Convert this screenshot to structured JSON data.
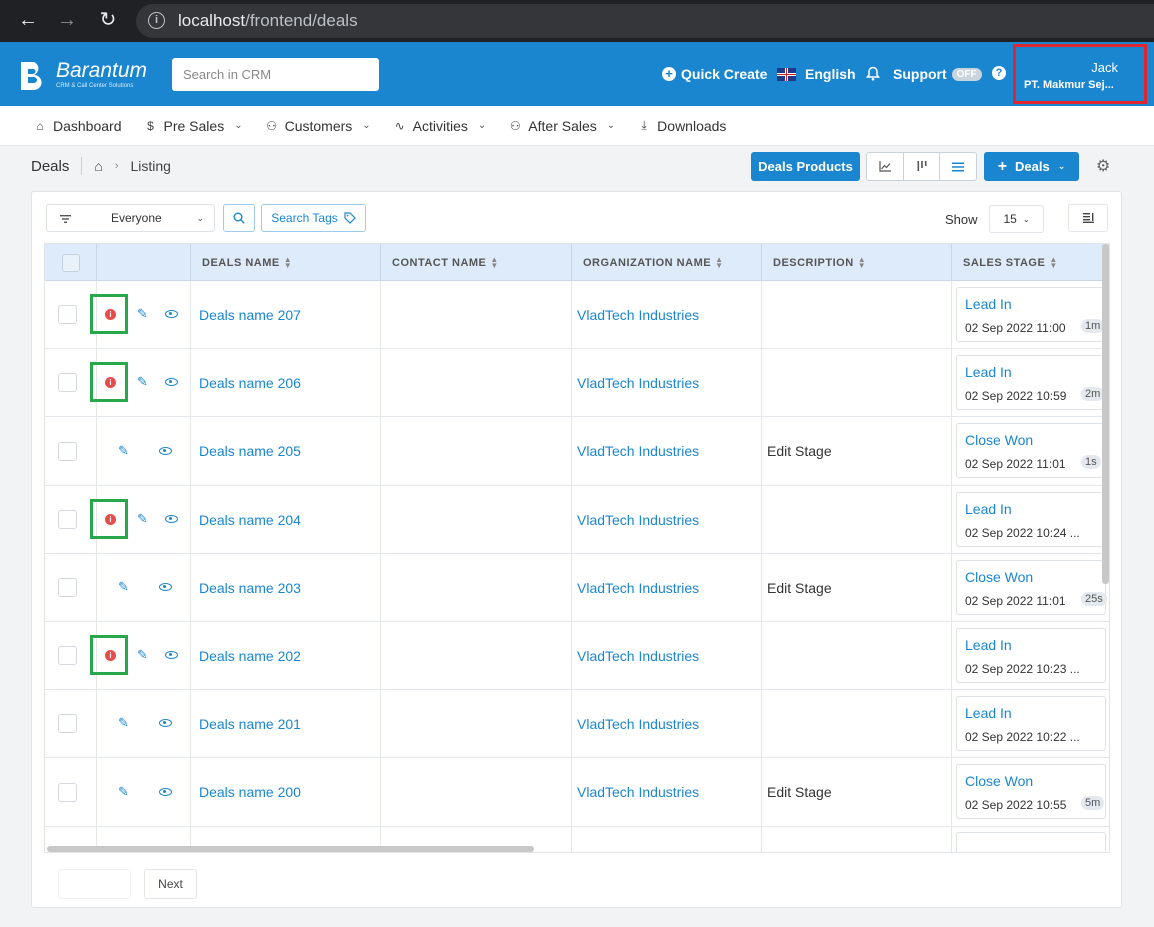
{
  "browser": {
    "url_host": "localhost",
    "url_path": "/frontend/deals"
  },
  "header": {
    "brand": "Barantum",
    "tagline": "CRM & Call Center Solutions",
    "search_placeholder": "Search in CRM",
    "quick_create": "Quick Create",
    "language": "English",
    "support": "Support",
    "support_status": "OFF",
    "user_name": "Jack",
    "user_org": "PT. Makmur Sej..."
  },
  "nav": {
    "items": [
      {
        "label": "Dashboard"
      },
      {
        "label": "Pre Sales"
      },
      {
        "label": "Customers"
      },
      {
        "label": "Activities"
      },
      {
        "label": "After Sales"
      },
      {
        "label": "Downloads"
      }
    ]
  },
  "page": {
    "title": "Deals",
    "crumb": "Listing",
    "deals_products_label": "Deals Products",
    "deals_button_label": "Deals"
  },
  "toolbar": {
    "filter_value": "Everyone",
    "search_tags_label": "Search Tags",
    "show_label": "Show",
    "show_value": "15"
  },
  "table": {
    "columns": [
      "DEALS NAME",
      "CONTACT NAME",
      "ORGANIZATION NAME",
      "DESCRIPTION",
      "SALES STAGE"
    ],
    "rows": [
      {
        "name": "Deals name 207",
        "contact": "",
        "org": "VladTech Industries",
        "desc": "",
        "stage": "Lead In",
        "date": "02 Sep 2022 11:00",
        "age": "1m"
      },
      {
        "name": "Deals name 206",
        "contact": "",
        "org": "VladTech Industries",
        "desc": "",
        "stage": "Lead In",
        "date": "02 Sep 2022 10:59",
        "age": "2m"
      },
      {
        "name": "Deals name 205",
        "contact": "",
        "org": "VladTech Industries",
        "desc": "Edit Stage",
        "stage": "Close Won",
        "date": "02 Sep 2022 11:01",
        "age": "1s"
      },
      {
        "name": "Deals name 204",
        "contact": "",
        "org": "VladTech Industries",
        "desc": "",
        "stage": "Lead In",
        "date": "02 Sep 2022 10:24 ...",
        "age": ""
      },
      {
        "name": "Deals name 203",
        "contact": "",
        "org": "VladTech Industries",
        "desc": "Edit Stage",
        "stage": "Close Won",
        "date": "02 Sep 2022 11:01",
        "age": "25s"
      },
      {
        "name": "Deals name 202",
        "contact": "",
        "org": "VladTech Industries",
        "desc": "",
        "stage": "Lead In",
        "date": "02 Sep 2022 10:23 ...",
        "age": ""
      },
      {
        "name": "Deals name 201",
        "contact": "",
        "org": "VladTech Industries",
        "desc": "",
        "stage": "Lead In",
        "date": "02 Sep 2022 10:22 ...",
        "age": ""
      },
      {
        "name": "Deals name 200",
        "contact": "",
        "org": "VladTech Industries",
        "desc": "Edit Stage",
        "stage": "Close Won",
        "date": "02 Sep 2022 10:55",
        "age": "5m"
      }
    ]
  },
  "pagination": {
    "next_label": "Next"
  }
}
